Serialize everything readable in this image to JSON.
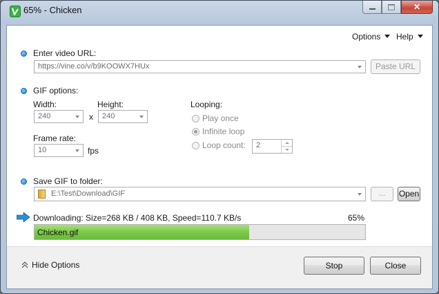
{
  "window": {
    "title": "65% - Chicken"
  },
  "menu": {
    "options": "Options",
    "help": "Help"
  },
  "url_section": {
    "label": "Enter video URL:",
    "value": "https://vine.co/v/b9KOOWX7HUx",
    "paste_button": "Paste URL"
  },
  "gif_options": {
    "label": "GIF options:",
    "width_label": "Width:",
    "width_value": "240",
    "times": "x",
    "height_label": "Height:",
    "height_value": "240",
    "framerate_label": "Frame rate:",
    "framerate_value": "10",
    "fps": "fps",
    "looping_label": "Looping:",
    "play_once": "Play once",
    "infinite_loop": "Infinite loop",
    "loop_count": "Loop count:",
    "loop_count_value": "2",
    "selected_loop": "infinite_loop"
  },
  "save_section": {
    "label": "Save GIF to folder:",
    "path": "E:\\Test\\Download\\GIF",
    "browse_button": "...",
    "open_button": "Open"
  },
  "download": {
    "status": "Downloading: Size=268 KB / 408 KB, Speed=110.7 KB/s",
    "percent_text": "65%",
    "progress": 0.65,
    "file_name": "Chicken.gif"
  },
  "footer": {
    "hide_options": "Hide Options",
    "stop_button": "Stop",
    "close_button": "Close"
  },
  "colors": {
    "accent_bullet": "#1c7ed6",
    "progress_fill": "#7dc94b"
  }
}
